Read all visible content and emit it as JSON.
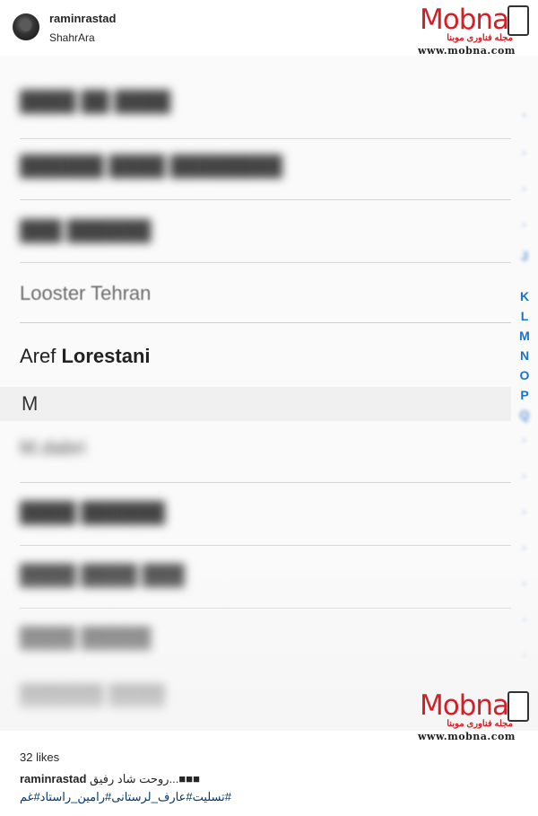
{
  "header": {
    "username": "raminrastad",
    "location": "ShahrAra"
  },
  "watermark": {
    "brand": "Mobna",
    "subtitle": "مجله فناوری موبنا",
    "url": "www.mobna.com"
  },
  "photo": {
    "blurred_rows": [
      "████ ██ ████",
      "██████ ████ ████████",
      "███ ██████",
      "████ ██████",
      "████ ████ ███",
      "████ █████",
      "██████ ████"
    ],
    "contacts": [
      {
        "label": "Looster Tehran"
      },
      {
        "first": "Aref",
        "last": "Lorestani"
      }
    ],
    "section_header": "M",
    "section_row": "M.dabri",
    "index_letters": [
      "J",
      "K",
      "L",
      "M",
      "N",
      "O",
      "P",
      "Q"
    ]
  },
  "footer": {
    "likes": "32 likes",
    "caption_user": "raminrastad",
    "caption_text": "روحت شاد رفیق...■■■",
    "hashtags": "#تسلیت#عارف_لرستانی#رامین_راستاد#غم"
  }
}
